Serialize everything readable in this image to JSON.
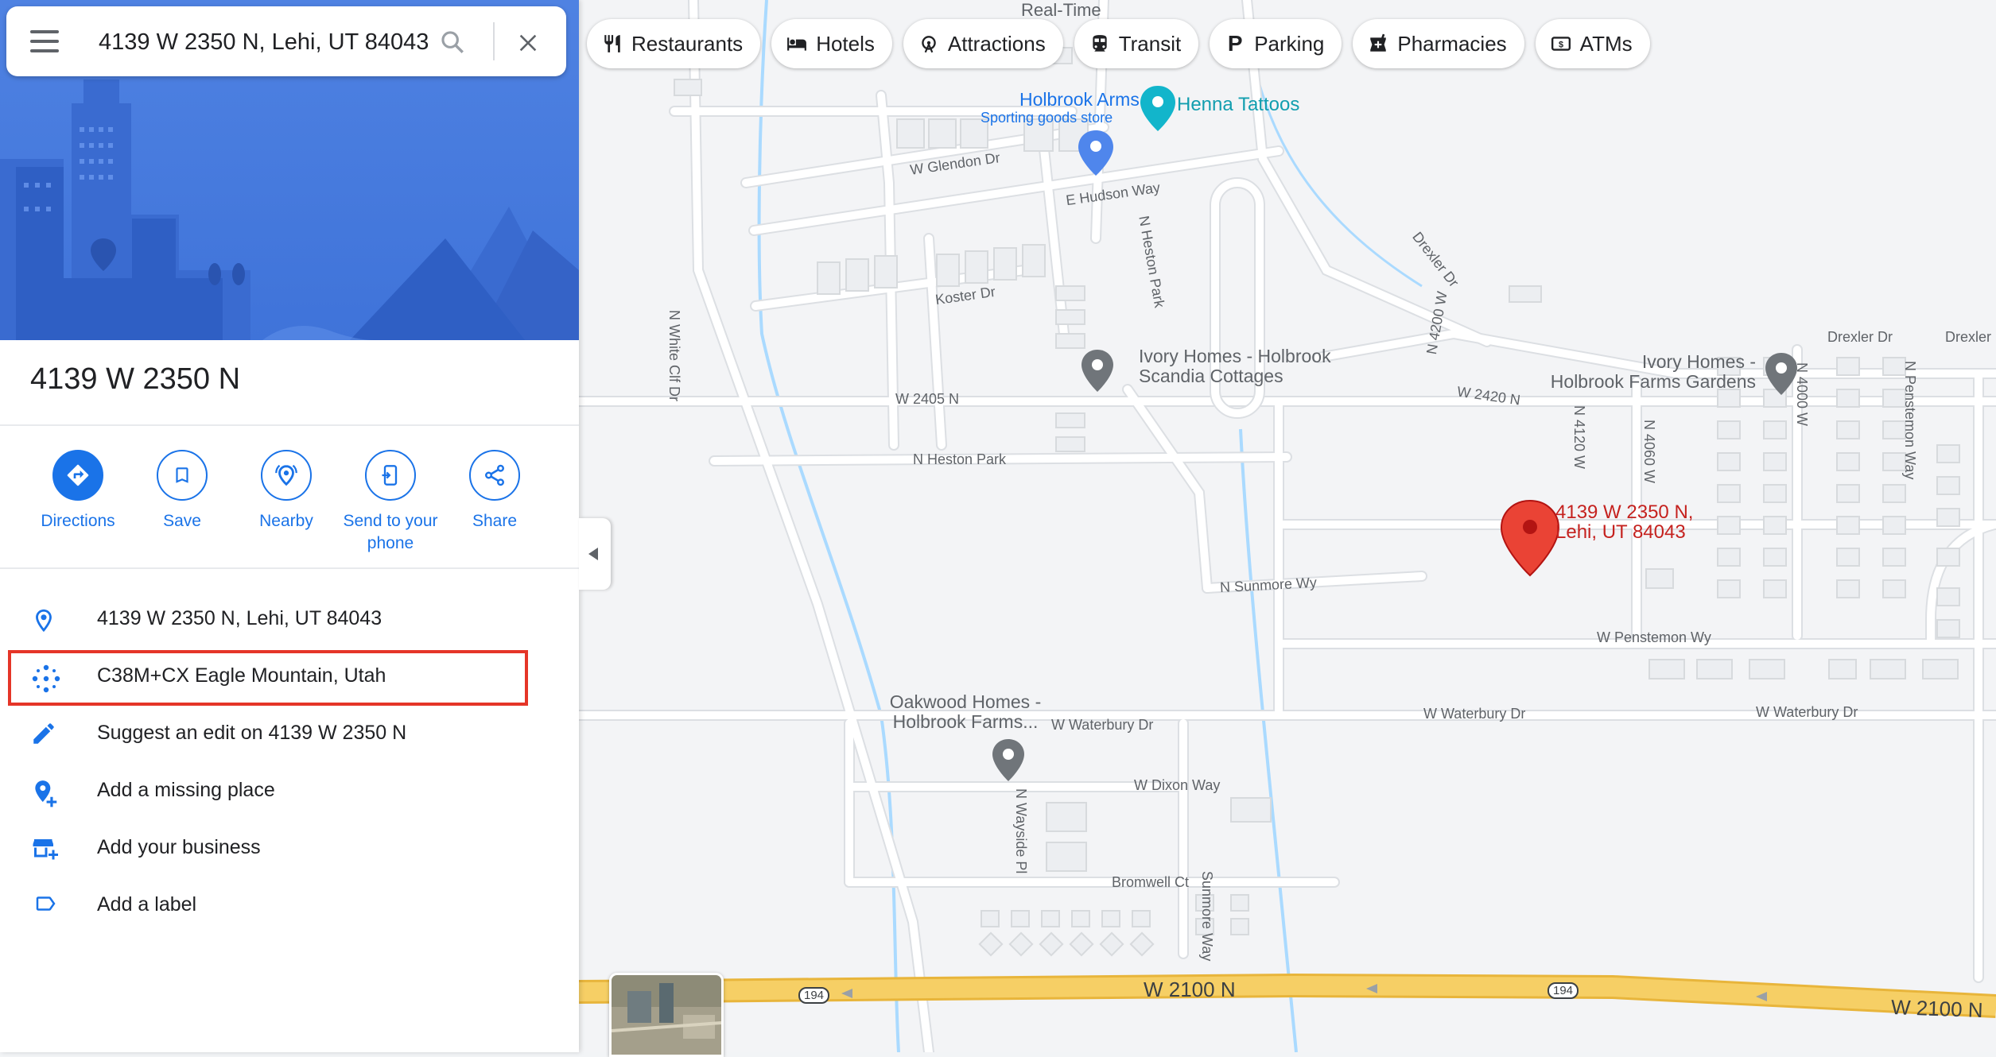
{
  "search": {
    "query": "4139 W 2350 N, Lehi, UT 84043"
  },
  "place": {
    "title": "4139 W 2350 N"
  },
  "actions": [
    {
      "label": "Directions",
      "icon": "directions-icon"
    },
    {
      "label": "Save",
      "icon": "bookmark-icon"
    },
    {
      "label": "Nearby",
      "icon": "nearby-icon"
    },
    {
      "label": "Send to your phone",
      "icon": "phone-icon"
    },
    {
      "label": "Share",
      "icon": "share-icon"
    }
  ],
  "info_rows": [
    {
      "text": "4139 W 2350 N, Lehi, UT 84043",
      "icon": "location-pin-icon"
    },
    {
      "text": "C38M+CX Eagle Mountain, Utah",
      "icon": "plus-code-icon"
    },
    {
      "text": "Suggest an edit on 4139 W 2350 N",
      "icon": "pencil-icon"
    },
    {
      "text": "Add a missing place",
      "icon": "add-place-icon"
    },
    {
      "text": "Add your business",
      "icon": "add-business-icon"
    },
    {
      "text": "Add a label",
      "icon": "label-icon"
    }
  ],
  "chips": [
    {
      "label": "Restaurants",
      "icon": "fork-knife-icon"
    },
    {
      "label": "Hotels",
      "icon": "bed-icon"
    },
    {
      "label": "Attractions",
      "icon": "ferris-wheel-icon"
    },
    {
      "label": "Transit",
      "icon": "train-icon"
    },
    {
      "label": "Parking",
      "icon": "parking-icon"
    },
    {
      "label": "Pharmacies",
      "icon": "pharmacy-icon"
    },
    {
      "label": "ATMs",
      "icon": "atm-icon"
    }
  ],
  "map": {
    "marker_label_line1": "4139 W 2350 N,",
    "marker_label_line2": "Lehi, UT 84043",
    "pois": {
      "holbrook_arms": "Holbrook Arms",
      "holbrook_arms_sub": "Sporting goods store",
      "henna": "Henna Tattoos",
      "ivory_scandia_1": "Ivory Homes - Holbrook",
      "ivory_scandia_2": "Scandia Cottages",
      "ivory_farms_1": "Ivory Homes -",
      "ivory_farms_2": "Holbrook Farms Gardens",
      "oakwood_1": "Oakwood Homes -",
      "oakwood_2": "Holbrook Farms...",
      "realtime": "Real-Time"
    },
    "streets": {
      "w_glendon_dr": "W Glendon Dr",
      "e_hudson_way": "E Hudson Way",
      "koster_dr": "Koster Dr",
      "n_white_cliff": "N White Clf Dr",
      "n_heston_park_v": "N Heston Park",
      "w_2405_n": "W 2405 N",
      "n_heston_park_h": "N Heston Park",
      "drexler_dr_diag": "Drexler Dr",
      "n_4200_w": "N 4200 W",
      "w_2420_n": "W 2420 N",
      "n_4120_w": "N 4120 W",
      "n_4060_w": "N 4060 W",
      "n_4000_w": "N 4000 W",
      "n_penstemon_way": "N Penstemon Way",
      "drexler_dr_1": "Drexler Dr",
      "drexler_dr_2": "Drexler",
      "n_sunmore_way": "N Sunmore Wy",
      "w_penstemon_way": "W Penstemon Wy",
      "w_waterbury_dr_1": "W Waterbury Dr",
      "w_waterbury_dr_2": "W Waterbury Dr",
      "w_waterbury_dr_3": "W Waterbury Dr",
      "w_dixon_way": "W Dixon Way",
      "n_wayside_pl": "N Wayside Pl",
      "bromwell_ct": "Bromwell Ct",
      "sunmore_way": "Sunmore Way",
      "w_2100_n_1": "W 2100 N",
      "w_2100_n_2": "W 2100 N",
      "route_1": "194",
      "route_2": "194"
    }
  },
  "colors": {
    "accent": "#1a73e8",
    "marker": "#ea4335",
    "highlight_box": "#e53528",
    "highway": "#f6cf65",
    "water": "#aadaff"
  }
}
